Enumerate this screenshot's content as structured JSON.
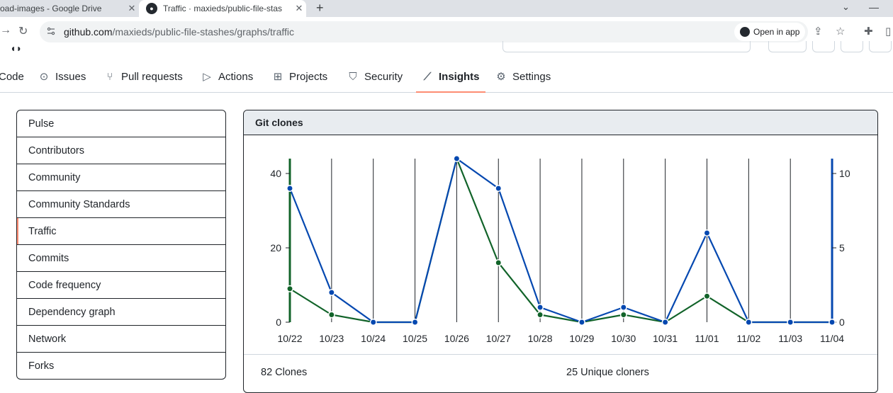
{
  "browser": {
    "tabs": [
      {
        "title": "oad-images - Google Drive",
        "active": false
      },
      {
        "title": "Traffic · maxieds/public-file-stas",
        "active": true
      }
    ],
    "url_host": "github.com",
    "url_path": "/maxieds/public-file-stashes/graphs/traffic",
    "open_in_app": "Open in app"
  },
  "repo_nav": [
    {
      "label": "Code",
      "icon": "code-icon"
    },
    {
      "label": "Issues",
      "icon": "issue-icon"
    },
    {
      "label": "Pull requests",
      "icon": "pull-request-icon"
    },
    {
      "label": "Actions",
      "icon": "play-icon"
    },
    {
      "label": "Projects",
      "icon": "table-icon"
    },
    {
      "label": "Security",
      "icon": "shield-icon"
    },
    {
      "label": "Insights",
      "icon": "graph-icon",
      "active": true
    },
    {
      "label": "Settings",
      "icon": "gear-icon"
    }
  ],
  "sidebar": {
    "items": [
      {
        "label": "Pulse"
      },
      {
        "label": "Contributors"
      },
      {
        "label": "Community"
      },
      {
        "label": "Community Standards"
      },
      {
        "label": "Traffic",
        "selected": true
      },
      {
        "label": "Commits"
      },
      {
        "label": "Code frequency"
      },
      {
        "label": "Dependency graph"
      },
      {
        "label": "Network"
      },
      {
        "label": "Forks"
      }
    ]
  },
  "clones": {
    "title": "Git clones",
    "total_label": "82 Clones",
    "unique_label": "25 Unique cloners"
  },
  "chart_data": {
    "type": "line",
    "title": "Git clones",
    "categories": [
      "10/22",
      "10/23",
      "10/24",
      "10/25",
      "10/26",
      "10/27",
      "10/28",
      "10/29",
      "10/30",
      "10/31",
      "11/01",
      "11/02",
      "11/03",
      "11/04"
    ],
    "series": [
      {
        "name": "Clones",
        "axis": "left",
        "color": "#116329",
        "values": [
          9,
          2,
          0,
          0,
          44,
          16,
          2,
          0,
          2,
          0,
          7,
          0,
          0,
          0
        ]
      },
      {
        "name": "Unique cloners",
        "axis": "right",
        "color": "#0548b0",
        "values": [
          9,
          2,
          0,
          0,
          11,
          9,
          1,
          0,
          1,
          0,
          6,
          0,
          0,
          0
        ]
      }
    ],
    "y_left": {
      "ticks": [
        0,
        20,
        40
      ],
      "range": [
        0,
        44
      ]
    },
    "y_right": {
      "ticks": [
        0,
        5,
        10
      ],
      "range": [
        0,
        11
      ]
    },
    "grid": "vertical"
  }
}
